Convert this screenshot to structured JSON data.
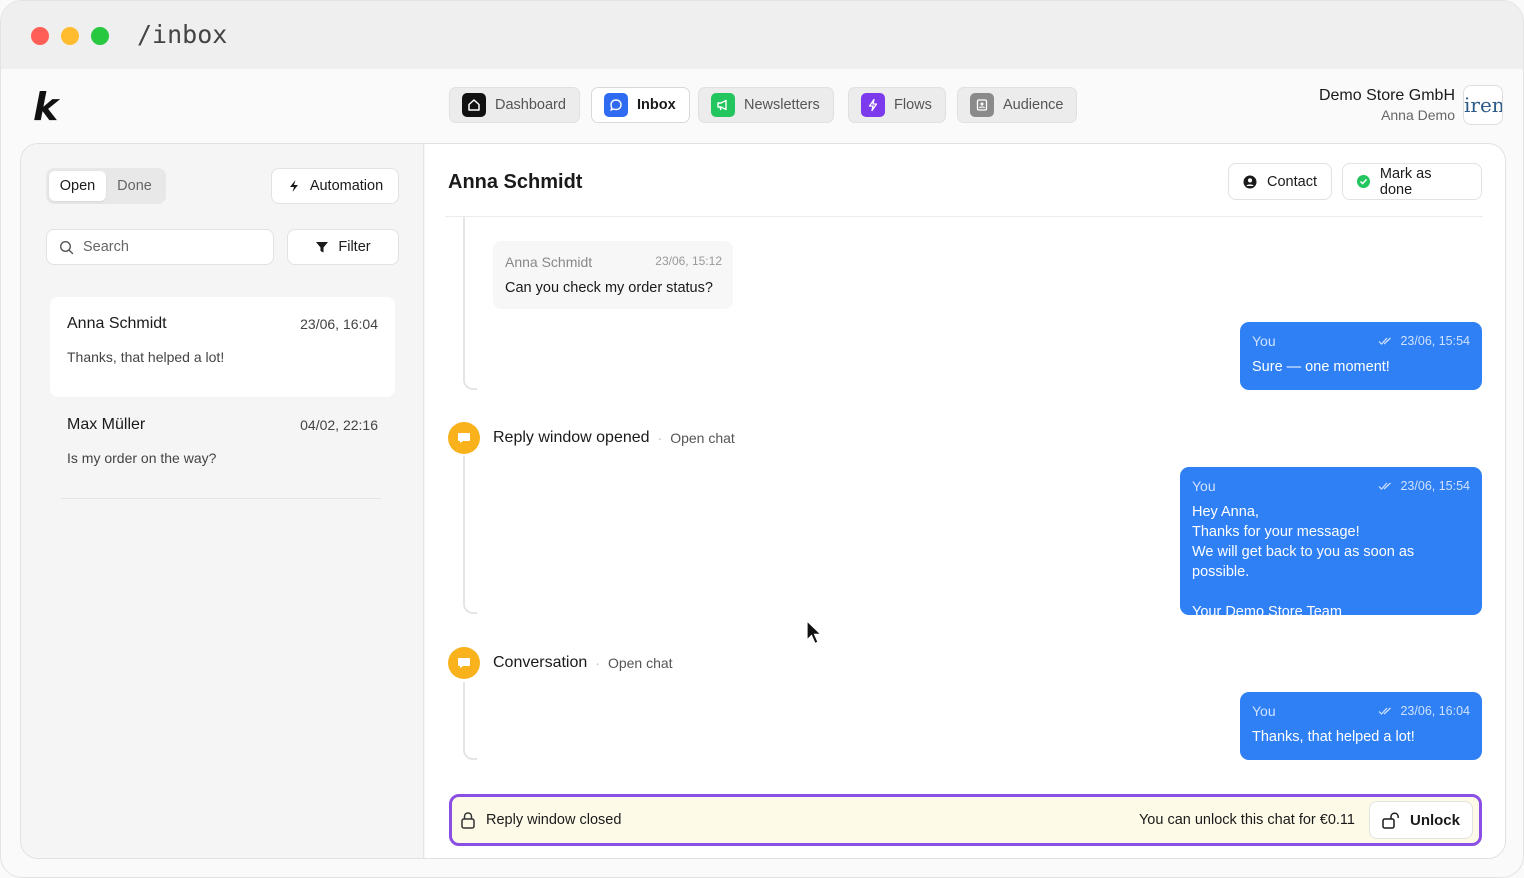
{
  "window": {
    "path": "/inbox"
  },
  "brand": {
    "logo_letter": "k"
  },
  "nav": {
    "items": [
      {
        "label": "Dashboard",
        "icon": "home-icon",
        "active": false
      },
      {
        "label": "Inbox",
        "icon": "chat-bubble-icon",
        "active": true
      },
      {
        "label": "Newsletters",
        "icon": "megaphone-icon",
        "active": false
      },
      {
        "label": "Flows",
        "icon": "lightning-icon",
        "active": false
      },
      {
        "label": "Audience",
        "icon": "contact-card-icon",
        "active": false
      }
    ],
    "colors": {
      "dashboard": "#111111",
      "inbox": "#2f6bf0",
      "newsletters": "#22c55e",
      "flows": "#7c3aed",
      "audience": "#8a8a8a"
    }
  },
  "account": {
    "store_name": "Demo Store GmbH",
    "user_name": "Anna Demo",
    "logo_text": "iren"
  },
  "sidebar": {
    "tabs": {
      "open": "Open",
      "done": "Done"
    },
    "automation_label": "Automation",
    "search_placeholder": "Search",
    "filter_label": "Filter",
    "conversations": [
      {
        "name": "Anna Schmidt",
        "date": "23/06, 16:04",
        "preview": "Thanks, that helped a lot!",
        "selected": true
      },
      {
        "name": "Max Müller",
        "date": "04/02, 22:16",
        "preview": "Is my order on the way?",
        "selected": false
      }
    ]
  },
  "chat": {
    "title": "Anna Schmidt",
    "contact_label": "Contact",
    "mark_done_label": "Mark as done",
    "incoming": {
      "sender": "Anna Schmidt",
      "time": "23/06, 15:12",
      "text": "Can you check my order status?"
    },
    "outgoing": [
      {
        "sender": "You",
        "time": "23/06, 15:54",
        "text": "Sure — one moment!"
      },
      {
        "sender": "You",
        "time": "23/06, 15:54",
        "text": "Hey Anna,\nThanks for your message!\nWe will get back to you as soon as possible.\n\nYour Demo Store Team"
      },
      {
        "sender": "You",
        "time": "23/06, 16:04",
        "text": "Thanks, that helped a lot!"
      }
    ],
    "events": [
      {
        "title": "Reply window opened",
        "link": "Open chat"
      },
      {
        "title": "Conversation",
        "link": "Open chat"
      }
    ],
    "event_separator": "·",
    "reply_closed": {
      "label": "Reply window closed",
      "unlock_text": "You can unlock this chat for €0.11",
      "unlock_button": "Unlock"
    },
    "colors": {
      "bubble": "#2f80f5",
      "event_dot": "#f9b21b",
      "closed_border": "#8b4fe6",
      "closed_bg": "#fdfbe8"
    }
  }
}
